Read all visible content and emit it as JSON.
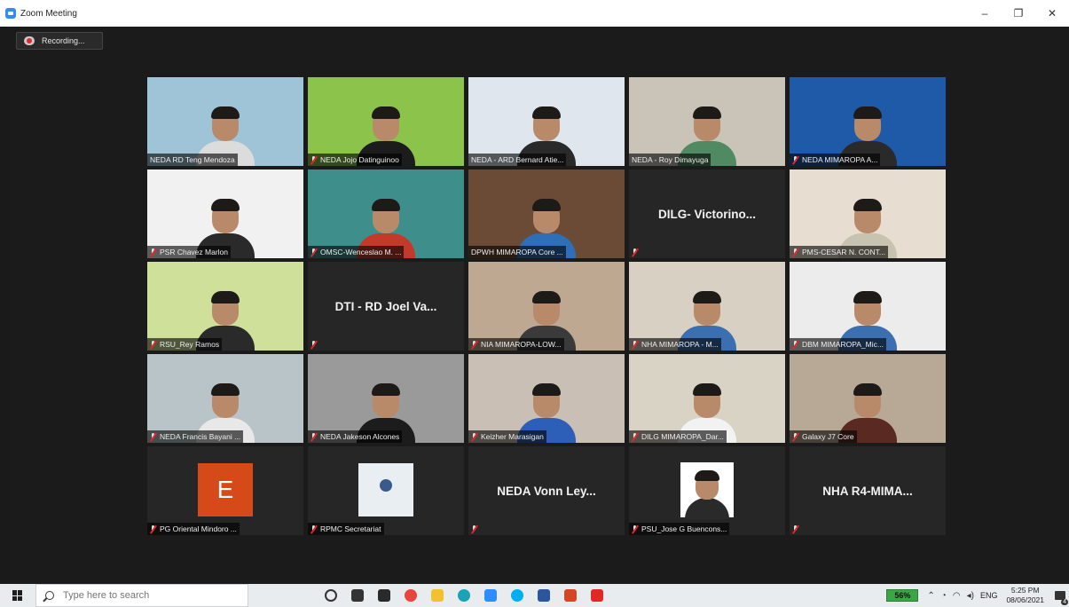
{
  "window": {
    "title": "Zoom Meeting",
    "minimize": "–",
    "maximize": "❐",
    "close": "✕"
  },
  "recording": {
    "label": "Recording..."
  },
  "tiles": [
    {
      "name": "NEDA RD Teng Mendoza",
      "muted": false,
      "type": "video",
      "bg": "#9fc4d8",
      "shirt": "#dcdcdc"
    },
    {
      "name": "NEDA Jojo Datinguinoo",
      "muted": true,
      "type": "video",
      "bg": "#8cc34a",
      "shirt": "#1c1c1c"
    },
    {
      "name": "NEDA - ARD Bernard Atie...",
      "muted": false,
      "type": "video",
      "bg": "#dfe6ee",
      "shirt": "#2a2a2a"
    },
    {
      "name": "NEDA - Roy Dimayuga",
      "muted": false,
      "type": "video",
      "bg": "#c9c3b8",
      "shirt": "#4f8a62"
    },
    {
      "name": "NEDA MIMAROPA A...",
      "muted": true,
      "type": "video",
      "bg": "#1f5aa8",
      "shirt": "#2a2a2a"
    },
    {
      "name": "PSR Chavez Marlon",
      "muted": true,
      "type": "video",
      "bg": "#f1f1f1",
      "shirt": "#2a2a2a"
    },
    {
      "name": "OMSC-Wenceslao M. ...",
      "muted": true,
      "type": "video",
      "bg": "#3e8f8c",
      "shirt": "#c23a2a"
    },
    {
      "name": "DPWH MIMAROPA Core ...",
      "muted": false,
      "type": "video",
      "bg": "#6b4a36",
      "shirt": "#2e6fb8",
      "active": true
    },
    {
      "name": "DILG- Victorino...",
      "muted": true,
      "type": "name"
    },
    {
      "name": "PMS-CESAR N. CONT...",
      "muted": true,
      "type": "video",
      "bg": "#e7ddd0",
      "shirt": "#c8c2b0"
    },
    {
      "name": "RSU_Rey Ramos",
      "muted": true,
      "type": "video",
      "bg": "#cfe09a",
      "shirt": "#2a2a2a"
    },
    {
      "name": "DTI - RD Joel Va...",
      "muted": true,
      "type": "name"
    },
    {
      "name": "NIA MIMAROPA-LOW...",
      "muted": true,
      "type": "video",
      "bg": "#bfa891",
      "shirt": "#3a3a3a"
    },
    {
      "name": "NHA MIMAROPA - M...",
      "muted": true,
      "type": "video",
      "bg": "#d8d0c3",
      "shirt": "#3c6fb0"
    },
    {
      "name": "DBM MIMAROPA_Mic...",
      "muted": true,
      "type": "video",
      "bg": "#ececec",
      "shirt": "#3c6fb0"
    },
    {
      "name": "NEDA Francis Bayani ...",
      "muted": true,
      "type": "video",
      "bg": "#b9c4c8",
      "shirt": "#e8e8e8"
    },
    {
      "name": "NEDA Jakeson Alcones",
      "muted": true,
      "type": "video",
      "bg": "#9a9a9a",
      "shirt": "#1c1c1c"
    },
    {
      "name": "Keizher Marasigan",
      "muted": true,
      "type": "video",
      "bg": "#c9bfb4",
      "shirt": "#2e5fb8"
    },
    {
      "name": "DILG MIMAROPA_Dar...",
      "muted": true,
      "type": "video",
      "bg": "#d9d3c6",
      "shirt": "#f2f2f2"
    },
    {
      "name": "Galaxy J7 Core",
      "muted": true,
      "type": "video",
      "bg": "#b7a996",
      "shirt": "#5a2a22"
    },
    {
      "name": "PG Oriental Mindoro ...",
      "muted": true,
      "type": "avatar-e",
      "initial": "E"
    },
    {
      "name": "RPMC Secretariat",
      "muted": true,
      "type": "avatar-rpmc"
    },
    {
      "name": "NEDA Vonn Ley...",
      "muted": true,
      "type": "name"
    },
    {
      "name": "PSU_Jose G Buencons...",
      "muted": true,
      "type": "avatar-psu"
    },
    {
      "name": "NHA R4-MIMA...",
      "muted": true,
      "type": "name"
    }
  ],
  "taskbar": {
    "search_placeholder": "Type here to search",
    "battery": "56%",
    "language": "ENG",
    "time": "5:25 PM",
    "date": "08/06/2021",
    "notifications": "4",
    "apps": [
      {
        "icon": "cortana-icon",
        "color": "#333333"
      },
      {
        "icon": "task-view-icon",
        "color": "#333333"
      },
      {
        "icon": "media-icon",
        "color": "#2a2a2a"
      },
      {
        "icon": "chrome-icon",
        "color": "#e8453c"
      },
      {
        "icon": "file-explorer-icon",
        "color": "#f2c12e"
      },
      {
        "icon": "edge-icon",
        "color": "#1aa3b8"
      },
      {
        "icon": "zoom-icon",
        "color": "#2d8cff"
      },
      {
        "icon": "skype-icon",
        "color": "#00aff0"
      },
      {
        "icon": "word-icon",
        "color": "#2b579a"
      },
      {
        "icon": "powerpoint-icon",
        "color": "#d24726"
      },
      {
        "icon": "acrobat-icon",
        "color": "#e02828"
      }
    ]
  }
}
